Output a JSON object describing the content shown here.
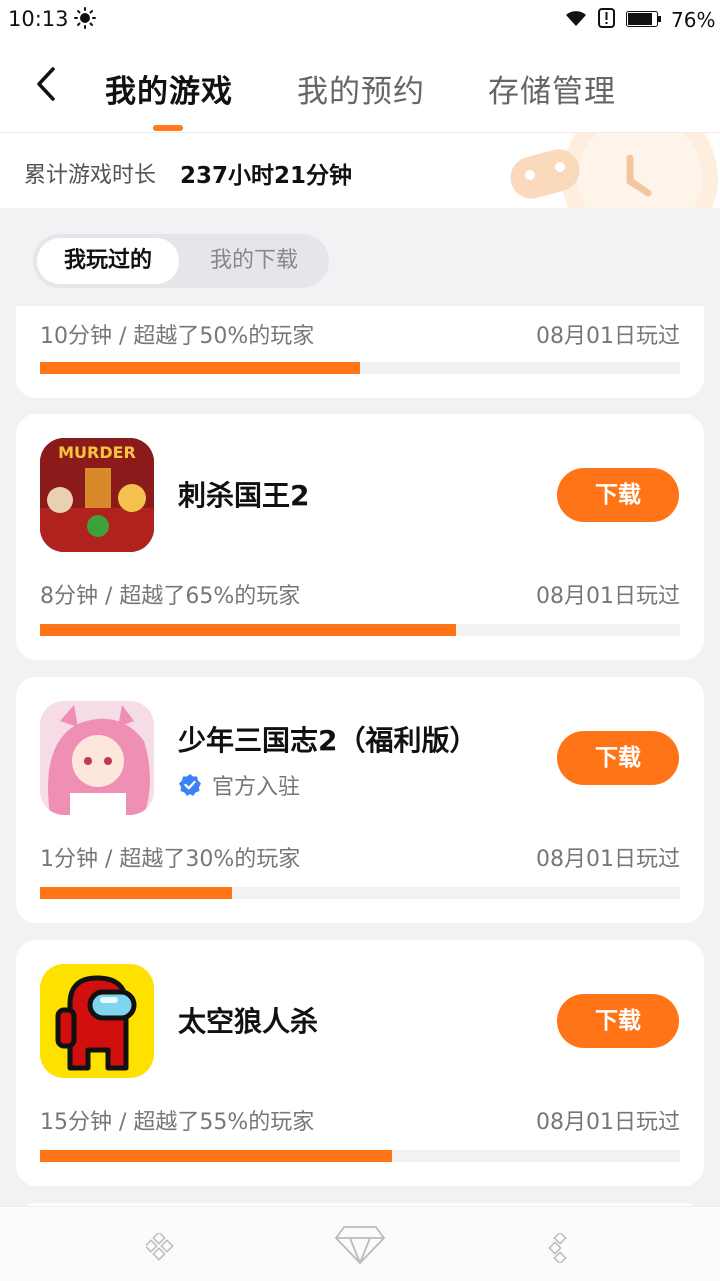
{
  "status_bar": {
    "time": "10:13",
    "battery": "76%"
  },
  "header": {
    "tabs": [
      {
        "label": "我的游戏"
      },
      {
        "label": "我的预约"
      },
      {
        "label": "存储管理"
      }
    ]
  },
  "summary": {
    "label": "累计游戏时长",
    "value": "237小时21分钟"
  },
  "filters": {
    "played": "我玩过的",
    "downloads": "我的下载"
  },
  "games": [
    {
      "stat": "10分钟 / 超越了50%的玩家",
      "date": "08月01日玩过",
      "progress": 0.5
    },
    {
      "name": "刺杀国王2",
      "button": "下载",
      "stat": "8分钟 / 超越了65%的玩家",
      "date": "08月01日玩过",
      "progress": 0.65,
      "icon_text": "MURDER"
    },
    {
      "name": "少年三国志2（福利版）",
      "badge": "官方入驻",
      "button": "下载",
      "stat": "1分钟 / 超越了30%的玩家",
      "date": "08月01日玩过",
      "progress": 0.3
    },
    {
      "name": "太空狼人杀",
      "button": "下载",
      "stat": "15分钟 / 超越了55%的玩家",
      "date": "08月01日玩过",
      "progress": 0.55
    }
  ],
  "colors": {
    "accent": "#ff7417",
    "verified": "#3b82f6"
  }
}
